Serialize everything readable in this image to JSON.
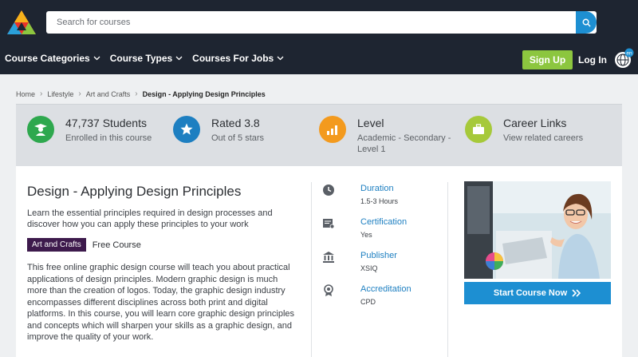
{
  "header": {
    "search_placeholder": "Search for courses",
    "nav": [
      "Course Categories",
      "Course Types",
      "Courses For Jobs"
    ],
    "signup": "Sign Up",
    "login": "Log In",
    "lang_badge": "en"
  },
  "breadcrumb": {
    "items": [
      "Home",
      "Lifestyle",
      "Art and Crafts"
    ],
    "current": "Design - Applying Design Principles"
  },
  "stats": [
    {
      "title": "47,737 Students",
      "sub": "Enrolled in this course",
      "icon": "graduate-icon",
      "color": "#2ea84e"
    },
    {
      "title": "Rated 3.8",
      "sub": "Out of 5 stars",
      "icon": "star-icon",
      "color": "#1d7fc1"
    },
    {
      "title": "Level",
      "sub1": "Academic - Secondary -",
      "sub2": "Level 1",
      "icon": "chart-icon",
      "color": "#f39a1e"
    },
    {
      "title": "Career Links",
      "sub": "View related careers",
      "icon": "briefcase-icon",
      "color": "#a6c93a"
    }
  ],
  "course": {
    "title": "Design - Applying Design Principles",
    "lead": "Learn the essential principles required in design processes and discover how you can apply these principles to your work",
    "tag": "Art and Crafts",
    "price": "Free Course",
    "description": "This free online graphic design course will teach you about practical applications of design principles. Modern graphic design is much more than the creation of logos. Today, the graphic design industry encompasses different disciplines across both print and digital platforms. In this course, you will learn core graphic design principles and concepts which will sharpen your skills as a graphic design, and improve the quality of your work."
  },
  "details": [
    {
      "label": "Duration",
      "value": "1.5-3 Hours",
      "icon": "clock-icon"
    },
    {
      "label": "Certification",
      "value": "Yes",
      "icon": "certificate-icon"
    },
    {
      "label": "Publisher",
      "value": "XSIQ",
      "icon": "institution-icon"
    },
    {
      "label": "Accreditation",
      "value": "CPD",
      "icon": "award-icon"
    }
  ],
  "cta": "Start Course Now",
  "colors": {
    "header_bg": "#1e2531",
    "accent_blue": "#1d8fd2",
    "signup_green": "#8cc63f",
    "tag_purple": "#3d1a4c"
  }
}
